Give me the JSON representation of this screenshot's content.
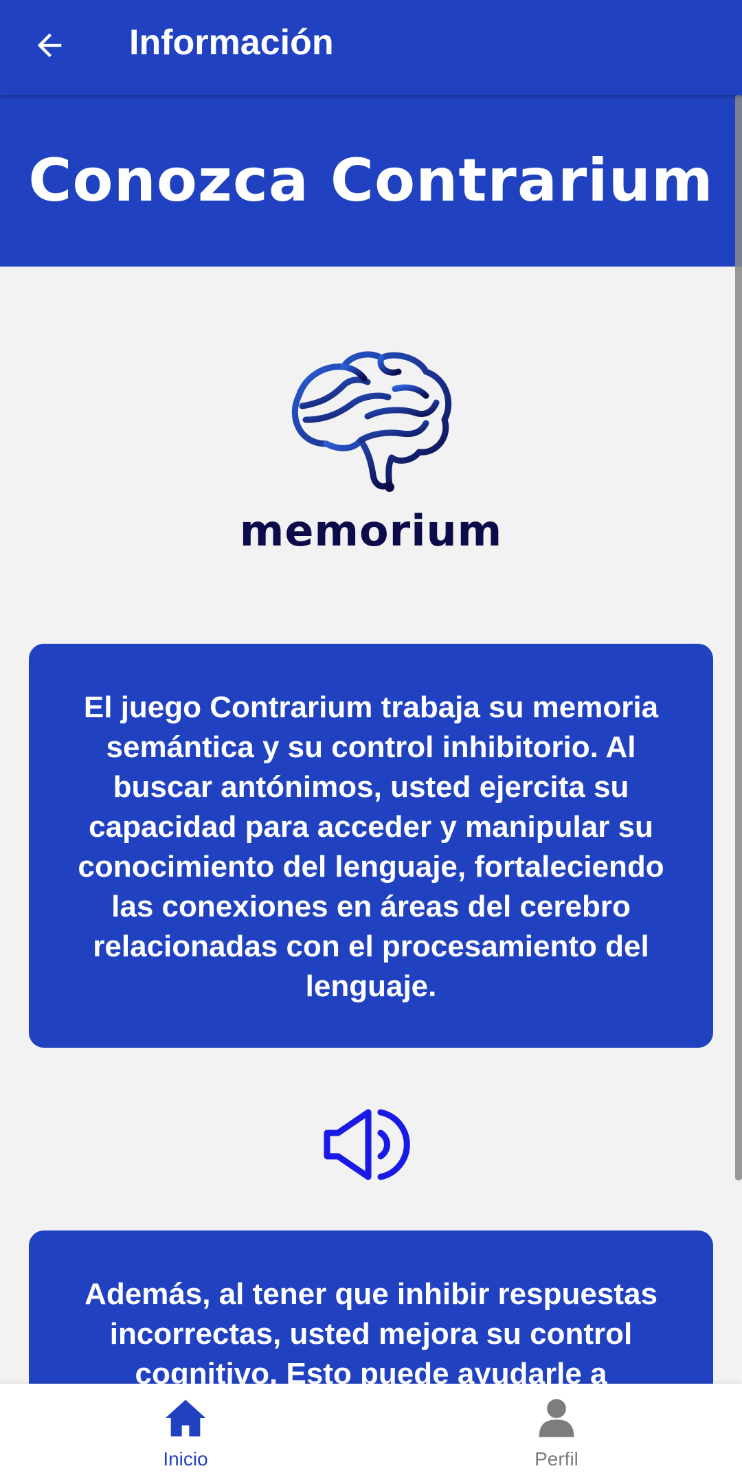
{
  "appbar": {
    "title": "Información",
    "back_icon": "arrow-left-icon"
  },
  "hero": {
    "title": "Conozca Contrarium"
  },
  "logo": {
    "text": "memorium",
    "icon": "brain-icon"
  },
  "cards": [
    {
      "text": "El juego Contrarium trabaja su memoria semántica y su control inhibitorio. Al buscar antónimos, usted ejercita su capacidad para acceder y manipular su conocimiento del lenguaje, fortaleciendo las conexiones en áreas del cerebro relacionadas con el procesamiento del lenguaje."
    },
    {
      "text": "Además, al tener que inhibir respuestas incorrectas, usted mejora su control cognitivo. Esto puede ayudarle a"
    }
  ],
  "speaker": {
    "icon": "speaker-icon"
  },
  "bottom_nav": {
    "items": [
      {
        "label": "Inicio",
        "icon": "home-icon",
        "active": true
      },
      {
        "label": "Perfil",
        "icon": "person-icon",
        "active": false
      }
    ]
  },
  "colors": {
    "primary": "#2142c0",
    "background": "#f2f2f2",
    "logo_dark": "#0c0c4a",
    "speaker_blue": "#1a1ae6",
    "nav_inactive": "#7d7d7d"
  }
}
